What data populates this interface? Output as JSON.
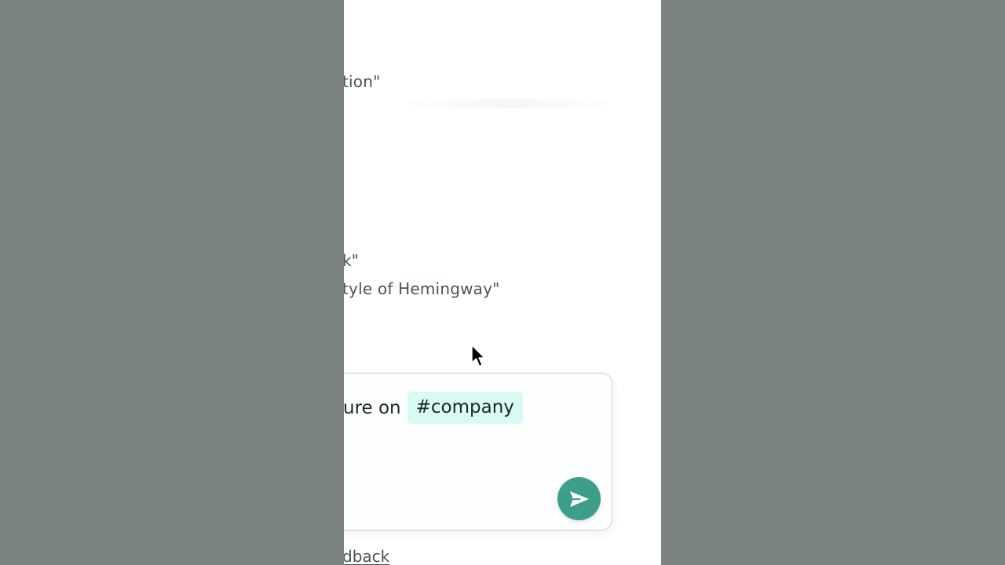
{
  "examples": {
    "line1": "tion\"",
    "line2": "k\"",
    "line3": "tyle of Hemingway\""
  },
  "composer": {
    "text_prefix": "ure on",
    "tag": "#company",
    "send_icon": "send-arrow-icon"
  },
  "footer": {
    "feedback_text": "dback"
  },
  "colors": {
    "backdrop": "#7b8381",
    "panel": "#ffffff",
    "accent": "#3e9e8c",
    "tag_background": "#d7faf5",
    "text": "#4a5553"
  }
}
